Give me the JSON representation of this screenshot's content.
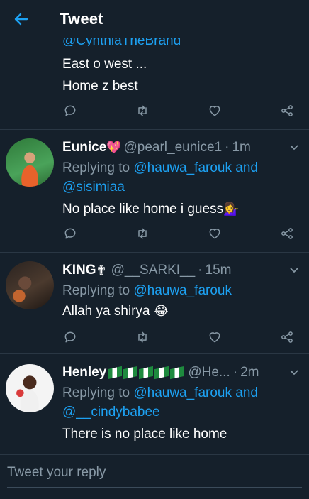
{
  "header": {
    "title": "Tweet"
  },
  "tweets": [
    {
      "handle": "@CynthiaTheBrand",
      "lines": [
        "East o west ...",
        "Home z best"
      ]
    },
    {
      "name": "Eunice",
      "name_emoji": "💖",
      "handle": "@pearl_eunice1",
      "dot": "·",
      "time": "1m",
      "replying_prefix": "Replying to ",
      "replying_to": "@hauwa_farouk and",
      "replying_to2": "@sisimiaa",
      "text": "No place like home i guess",
      "text_emoji": "💁‍♀️"
    },
    {
      "name": "KING",
      "name_emoji": "✟",
      "handle": "@__SARKI__",
      "dot": "·",
      "time": "15m",
      "replying_prefix": "Replying to ",
      "replying_to": "@hauwa_farouk",
      "text": "Allah ya shirya",
      "text_emoji": "😂"
    },
    {
      "name": "Henley",
      "name_emoji": "",
      "handle": "@He...",
      "dot": "·",
      "time": "2m",
      "replying_prefix": "Replying to ",
      "replying_to": "@hauwa_farouk and",
      "replying_to2": "@__cindybabee",
      "text": "There is no place like home"
    }
  ],
  "reply": {
    "placeholder": "Tweet your reply"
  },
  "colors": {
    "background": "#15202b",
    "accent": "#1da1f2",
    "secondary_text": "#8899a6",
    "divider": "#2a3744"
  },
  "icons": {
    "back": "arrow-left-icon",
    "reply": "comment-icon",
    "retweet": "retweet-icon",
    "like": "heart-icon",
    "share": "share-icon",
    "menu": "chevron-down-icon"
  }
}
